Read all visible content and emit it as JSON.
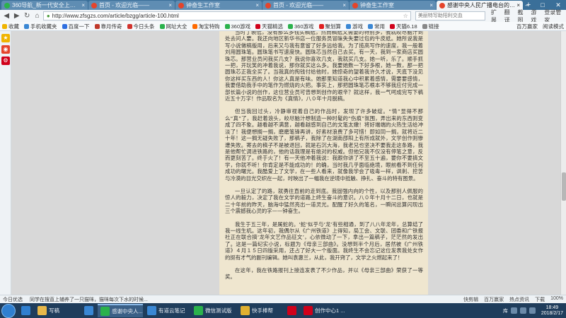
{
  "tabs": [
    {
      "label": "360导航_新一代安全上网导航",
      "active": false,
      "color": "#2bb24c"
    },
    {
      "label": "首页 - 欢迎光临——",
      "active": false,
      "color": "#e5442b"
    },
    {
      "label": "钟奋生工作室",
      "active": false,
      "color": "#e5442b"
    },
    {
      "label": "首页 - 欢迎光临——",
      "active": false,
      "color": "#e5442b"
    },
    {
      "label": "钟奋生工作室",
      "active": false,
      "color": "#e5442b"
    },
    {
      "label": "感谢中央人民广播电台的“中国广",
      "active": true,
      "color": "#e5442b"
    }
  ],
  "address": {
    "url": "http://www.zfsgzs.com/article/bzgg/article-100.html",
    "search_placeholder": "美丽特写助阳利交血"
  },
  "toolbar_right": [
    "扩展",
    "翻译",
    "截图",
    "游戏",
    "登录管家"
  ],
  "bookmarks": [
    {
      "label": "收藏",
      "color": "#f0b400"
    },
    {
      "label": "手机收藏夹",
      "color": "#3a87d4"
    },
    {
      "label": "百度一下",
      "color": "#2f6fe0"
    },
    {
      "label": "靠月传奇",
      "color": "#c0392b"
    },
    {
      "label": "今日头条",
      "color": "#d2332e"
    },
    {
      "label": "网址大全",
      "color": "#2bb24c"
    },
    {
      "label": "淘宝特购",
      "color": "#ff6a00"
    },
    {
      "label": "360游戏",
      "color": "#2bb24c"
    },
    {
      "label": "天猫精选",
      "color": "#d0011b"
    },
    {
      "label": "360游戏",
      "color": "#2bb24c"
    },
    {
      "label": "聚划算",
      "color": "#e02020"
    },
    {
      "label": "游戏",
      "color": "#3a87d4"
    },
    {
      "label": "常用",
      "color": "#3a87d4"
    },
    {
      "label": "天猫6.18",
      "color": "#d0011b"
    },
    {
      "label": "链接",
      "color": "#888888"
    }
  ],
  "bookmarks_right": [
    "百万赢家",
    "阅读模式"
  ],
  "article": {
    "paragraphs": [
      "当时丁裘低，没有那么多钱买稿纸，然而稿纸又需要的特别多，我就皎尽脑汁到处去问人要。我还向地区新华书店一位服务员冒昧失失要过包的牛皮纸。她所说我是写小说做稿版用，后来又与我有意留了好多远给我。为了揽高写作的速度，我一般着刘用圆珠笔。圆珠笔书写速度快。圆珠芯当然自己去买。有一天，我到一家商店买圆珠芯。那营业员问我买几支？我说你喜欢几支，我就买几支。她一听，乐了。顺手抓一把，开玩笑的冲着我说，那你就买这么多。我要她数一下好多根，她一数，那一把圆珠芯正我全买了。当我真的掏钱付给他时，她惊奇的望着我许久才说，天底下没见你这样买东西的人！你这人真是有味。她那里知道我心中积累着感情，需要要感情，我要借助我手中的笔作为燃烧的火把。事实上，那把圆珠笔芯根本不够我应付完成一部长篇小说的创作，这位营业员可曾想到创作的艰辛？就这样，我一气呵成完写下稿近五十万字！作品取名为《真情》，八０年十月脱稿。",
      "但当我回过头，冷静审视着自己的作品时，发现了许多破绽。“情”显得不那么“真”了，我赶着浪头，皎尽脑汁想制造一种时髦的“伤痕”氛围，弄出来的东西则变成了四不象。越看越不满意，越看越感到自己的文笔太嫩！将好端端的火热生活给冲淡了！我便想搁一搁，磨磨笔锋再讲，好素材浪费了多可惜！即如同一搁，就将近二十年！这一搁无疑失败了，那稿子，我除了在湖南邵阳上有所成就外，文学创作则惨遭失败。寄去的稿子不是被退回，就是石沉大海，我老兄也坚决不要我走这条路，我是他帮忙调进铁路的，他的话我理是有绝对的权威。但他兄我不仅没有停笔之意，反而更刻苦了。终于火了！有一天他冲着我说：我跟你讲了不至五十遍，要你不要搞文学，你就不听！你肯定是不能成功的！的确，当时我几乎面临绝境，眼前看不到任何成功的曙光。我酷爱上了文学，在一些人看来，就像我学会了吸毒一样，讽刺、挖苦与冷漠的目光交织在一起，时映出了一幅我在逆境中抵触、挣扎、奋斗的特有图景。",
      "一旦认定了的路，就勇往直前的走到底。我固强内向的个性，以及那别人佩服的惊人的毅力，决定了我在文学的道路上终生奋斗的意识。八０年十月十二日，也就是二十年前的昨天，脑海中猛然亮出一道灵光。配醒了好久的笔名，一瞬间总算闪现出三个震撼我心灵的字——钟奋生。",
      "我生于五三年，是属蛇的。‘蛇’似乎与‘龙’有些相通，到了八八年龙年，总算结了我一线生机。这年初，我偶尔从《广州铁道》上得知，局工会、文联、团委和广铁报社正在联合搞‘龙年文艺作品征文’，心依微动了一下，拿出一篇稿子，茫茫然的发出了。这是一篇纪实小说，标题为《母亲三部曲》。没想到半个月后，居然被《广州铁道》４月１５日四版采用，还占了好大一个版面。我终生不会忘记这位发表我处女作的挺有才气的副刊编辑。她叫袁惠兰，从此，我开窍了，文学之火燃起来了！",
      "在这年，我在铁路报刊上接连发表了不少作品，并以《母亲三部曲》荣获了一等奖。"
    ]
  },
  "statusbar": {
    "left": [
      "今日优选",
      "同学在搜直上辅养了一只猫咪，猫咪每次下水的时候..."
    ],
    "right": [
      "快剪辑",
      "百万赢家",
      "热点资讯",
      "下载",
      "100%"
    ]
  },
  "taskbar": {
    "items": [
      {
        "label": "",
        "color": "#2f7fd0",
        "wide": false
      },
      {
        "label": "写稿",
        "color": "#e8b84a",
        "wide": true
      },
      {
        "label": "",
        "color": "#3a87d4",
        "wide": false
      },
      {
        "label": "感谢中央人...",
        "color": "#2bb24c",
        "wide": true,
        "active": true
      },
      {
        "label": "有道云笔记",
        "color": "#3a87d4",
        "wide": true
      },
      {
        "label": "微信测试版",
        "color": "#2bb24c",
        "wide": true
      },
      {
        "label": "快手棒帮",
        "color": "#e0b030",
        "wide": true
      },
      {
        "label": "",
        "color": "#d0011b",
        "wide": false
      },
      {
        "label": "创作中心1 ...",
        "color": "#d0011b",
        "wide": true
      }
    ],
    "tray_label": "库",
    "time": "18:49",
    "date": "2018/2/17"
  }
}
